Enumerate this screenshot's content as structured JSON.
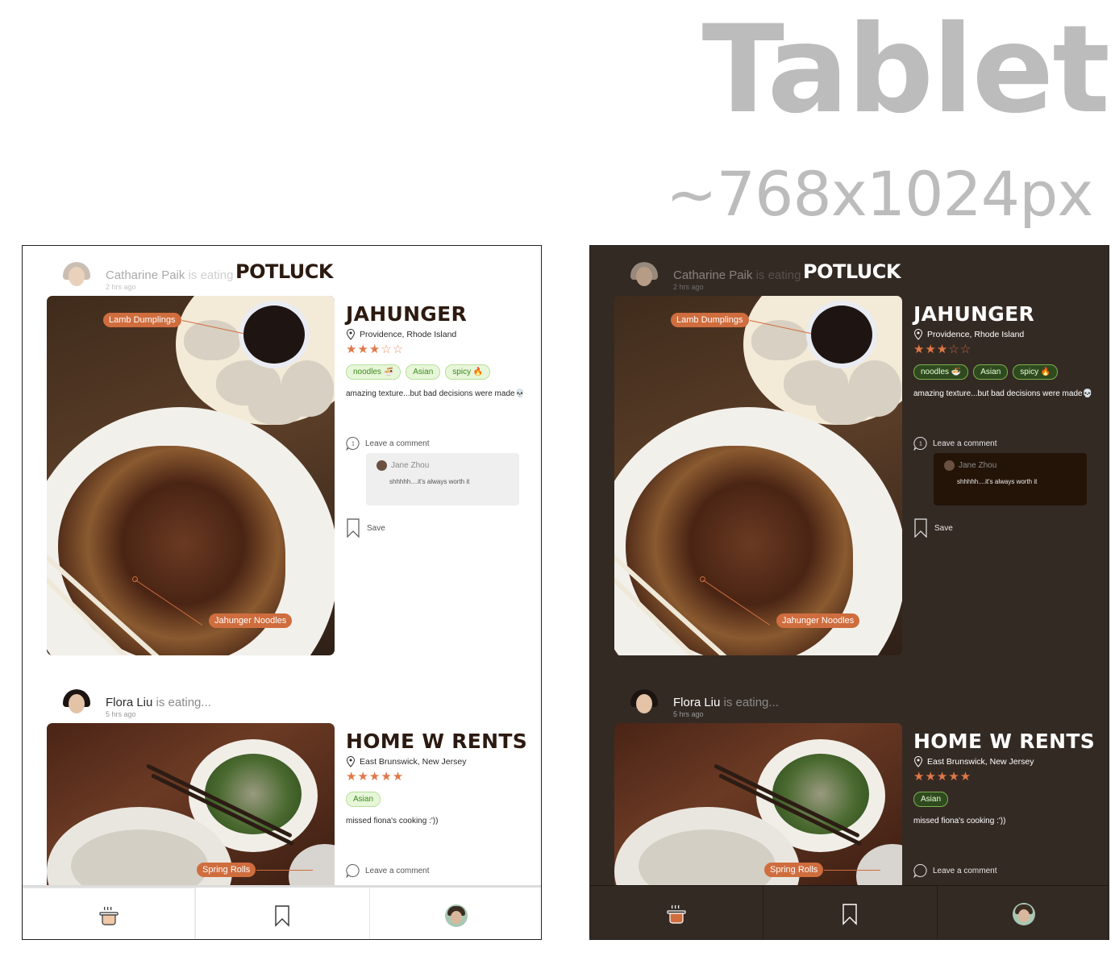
{
  "header": {
    "title": "Tablet",
    "size": "~768x1024px"
  },
  "app": {
    "brand": "POTLUCK"
  },
  "posts": [
    {
      "user": "Catharine Paik",
      "verb": "is eating...",
      "time": "2 hrs ago",
      "restaurant": "JAHUNGER",
      "location": "Providence, Rhode Island",
      "rating": 3,
      "rating_max": 5,
      "tags": [
        "noodles 🍜",
        "Asian",
        "spicy 🔥"
      ],
      "caption": "amazing texture...but bad decisions were made💀",
      "photo_labels": [
        "Lamb Dumplings",
        "Jahunger Noodles"
      ],
      "comment_count": "1",
      "comment_prompt": "Leave a comment",
      "reply": {
        "user": "Jane Zhou",
        "text": "shhhhh....it's always worth it"
      },
      "save_label": "Save"
    },
    {
      "user": "Flora Liu",
      "verb": "is eating...",
      "time": "5 hrs ago",
      "restaurant": "HOME W RENTS",
      "location": "East Brunswick, New Jersey",
      "rating": 5,
      "rating_max": 5,
      "tags": [
        "Asian"
      ],
      "caption": "missed fiona's cooking :'))",
      "photo_labels": [
        "Spring Rolls"
      ],
      "comment_prompt": "Leave a comment"
    }
  ],
  "nav": {
    "items": [
      {
        "icon": "cooking-pot-icon",
        "active": true
      },
      {
        "icon": "bookmark-icon",
        "active": false
      },
      {
        "icon": "profile-avatar-icon",
        "active": false
      }
    ]
  },
  "colors": {
    "accent": "#cf6d3e",
    "star": "#e07847",
    "light_bg": "#ffffff",
    "dark_bg": "#342a24",
    "header_gray": "#bcbcbc",
    "chip_green": "#3c8a1e"
  }
}
